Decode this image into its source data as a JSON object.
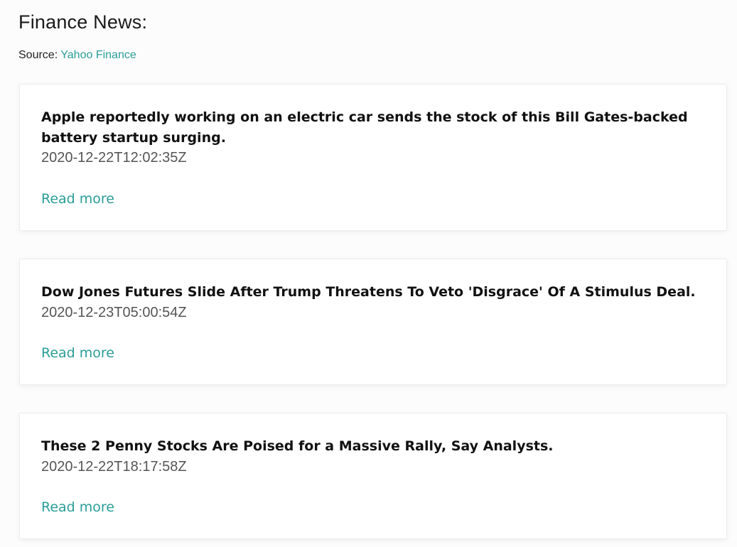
{
  "header": {
    "title": "Finance News:",
    "source_prefix": "Source:",
    "source_link": "Yahoo Finance"
  },
  "articles": [
    {
      "headline": "Apple reportedly working on an electric car sends the stock of this Bill Gates-backed battery startup surging.",
      "date": "2020-12-22T12:02:35Z",
      "link_label": "Read more"
    },
    {
      "headline": "Dow Jones Futures Slide After Trump Threatens To Veto 'Disgrace' Of A Stimulus Deal.",
      "date": "2020-12-23T05:00:54Z",
      "link_label": "Read more"
    },
    {
      "headline": "These 2 Penny Stocks Are Poised for a Massive Rally, Say Analysts.",
      "date": "2020-12-22T18:17:58Z",
      "link_label": "Read more"
    }
  ],
  "colors": {
    "accent": "#2a9d98",
    "background": "#fcfcfc",
    "card": "#ffffff"
  }
}
